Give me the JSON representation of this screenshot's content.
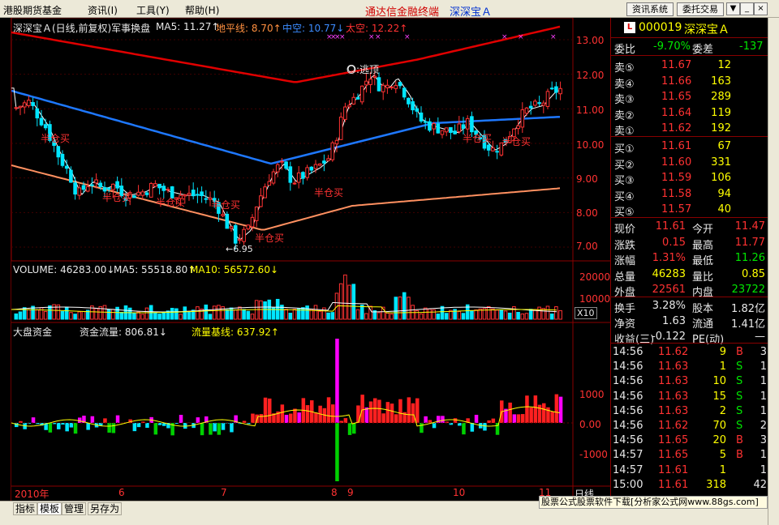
{
  "menu": {
    "items": [
      "港股期货基金",
      "资讯(I)",
      "工具(Y)",
      "帮助(H)"
    ],
    "app_title": "通达信金融终端",
    "stock_title": "深深宝Ａ",
    "buttons": [
      "资讯系统",
      "委托交易"
    ],
    "controls": [
      "▼",
      "_",
      "□",
      "×"
    ]
  },
  "chart": {
    "header": {
      "name": "深深宝Ａ(日线,前复权)军事换盘",
      "ma5": "MA5: 11.27↑",
      "dpx": "地平线: 8.70↑",
      "zk": "中空: 10.77↓",
      "tk": "太空: 12.22↑"
    },
    "price_ticks": [
      "13.00",
      "12.00",
      "11.00",
      "10.00",
      "9.00",
      "8.00",
      "7.00"
    ],
    "annotations": {
      "top": "〇:逃顶",
      "low": "←6.95",
      "half_buy": "半仓买"
    },
    "volume_header": {
      "volume": "VOLUME: 46283.00↓",
      "ma5": "MA5: 55518.80↑",
      "ma10": "MA10: 56572.60↓"
    },
    "volume_ticks": [
      "20000",
      "10000"
    ],
    "volume_unit": "X10",
    "fund_header": {
      "name": "大盘资金",
      "flow": "资金流量: 806.81↓",
      "base": "流量基线: 637.92↑"
    },
    "fund_ticks": [
      "1000",
      "0.00",
      "-1000"
    ],
    "time_axis": [
      "2010年",
      "6",
      "7",
      "8",
      "9",
      "10",
      "11"
    ],
    "period_label": "日线"
  },
  "quote": {
    "code": "000019",
    "name": "深深宝Ａ",
    "wb_label": "委比",
    "wb_value": "-9.70%",
    "wc_label": "委差",
    "wc_value": "-137",
    "asks": [
      {
        "label": "卖⑤",
        "price": "11.67",
        "vol": "12"
      },
      {
        "label": "卖④",
        "price": "11.66",
        "vol": "163"
      },
      {
        "label": "卖③",
        "price": "11.65",
        "vol": "289"
      },
      {
        "label": "卖②",
        "price": "11.64",
        "vol": "119"
      },
      {
        "label": "卖①",
        "price": "11.62",
        "vol": "192"
      }
    ],
    "bids": [
      {
        "label": "买①",
        "price": "11.61",
        "vol": "67"
      },
      {
        "label": "买②",
        "price": "11.60",
        "vol": "331"
      },
      {
        "label": "买③",
        "price": "11.59",
        "vol": "106"
      },
      {
        "label": "买④",
        "price": "11.58",
        "vol": "94"
      },
      {
        "label": "买⑤",
        "price": "11.57",
        "vol": "40"
      }
    ],
    "stats": [
      {
        "l1": "现价",
        "v1": "11.61",
        "l2": "今开",
        "v2": "11.47"
      },
      {
        "l1": "涨跌",
        "v1": "0.15",
        "l2": "最高",
        "v2": "11.77"
      },
      {
        "l1": "涨幅",
        "v1": "1.31%",
        "l2": "最低",
        "v2": "11.26"
      },
      {
        "l1": "总量",
        "v1": "46283",
        "l2": "量比",
        "v2": "0.85"
      },
      {
        "l1": "外盘",
        "v1": "22561",
        "l2": "内盘",
        "v2": "23722"
      }
    ],
    "stats2": [
      {
        "l1": "换手",
        "v1": "3.28%",
        "l2": "股本",
        "v2": "1.82亿"
      },
      {
        "l1": "净资",
        "v1": "1.63",
        "l2": "流通",
        "v2": "1.41亿"
      },
      {
        "l1": "收益(三)",
        "v1": "-0.122",
        "l2": "PE(动)",
        "v2": "—"
      }
    ],
    "ticks": [
      {
        "time": "14:56",
        "price": "11.62",
        "vol": "9",
        "side": "B",
        "n": "3"
      },
      {
        "time": "14:56",
        "price": "11.63",
        "vol": "1",
        "side": "S",
        "n": "1"
      },
      {
        "time": "14:56",
        "price": "11.63",
        "vol": "10",
        "side": "S",
        "n": "1"
      },
      {
        "time": "14:56",
        "price": "11.63",
        "vol": "15",
        "side": "S",
        "n": "1"
      },
      {
        "time": "14:56",
        "price": "11.63",
        "vol": "2",
        "side": "S",
        "n": "1"
      },
      {
        "time": "14:56",
        "price": "11.62",
        "vol": "70",
        "side": "S",
        "n": "2"
      },
      {
        "time": "14:56",
        "price": "11.65",
        "vol": "20",
        "side": "B",
        "n": "3"
      },
      {
        "time": "14:57",
        "price": "11.65",
        "vol": "5",
        "side": "B",
        "n": "1"
      },
      {
        "time": "14:57",
        "price": "11.61",
        "vol": "1",
        "side": "",
        "n": "1"
      },
      {
        "time": "15:00",
        "price": "11.61",
        "vol": "318",
        "side": "",
        "n": "42"
      }
    ]
  },
  "bottom": {
    "tabs": [
      "指标",
      "模板",
      "管理",
      "另存为"
    ],
    "promo": "股票公式股票软件下载[分析家公式网www.88gs.com]"
  }
}
